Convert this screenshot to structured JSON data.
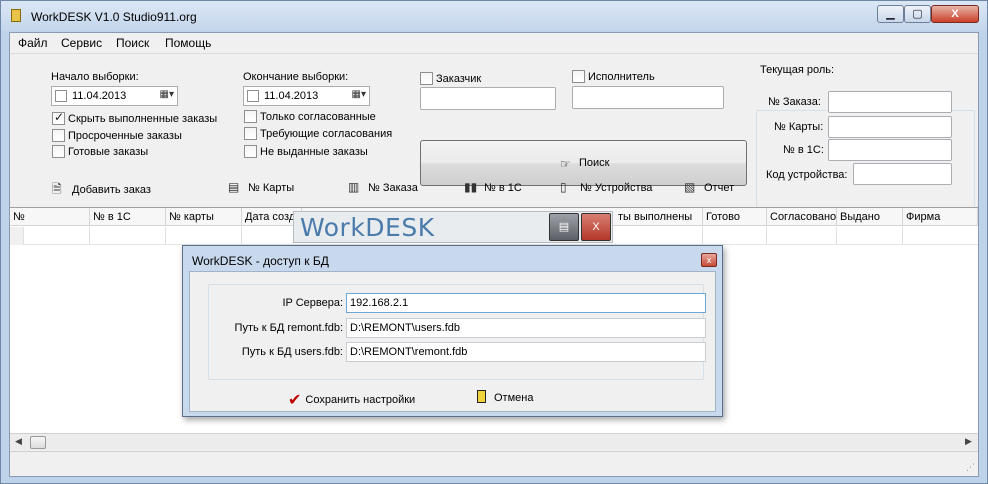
{
  "window": {
    "title": "WorkDESK V1.0 Studio911.org",
    "min_label": "▁",
    "max_label": "▢",
    "close_label": "X"
  },
  "menu": [
    "Файл",
    "Сервис",
    "Поиск",
    "Помощь"
  ],
  "filters": {
    "start_label": "Начало выборки:",
    "start_date": "11.04.2013",
    "end_label": "Окончание выборки:",
    "end_date": "11.04.2013",
    "left_checks": [
      {
        "label": "Скрыть выполненные заказы",
        "checked": true
      },
      {
        "label": "Просроченные заказы",
        "checked": false
      },
      {
        "label": "Готовые заказы",
        "checked": false
      }
    ],
    "right_checks": [
      {
        "label": "Только согласованные",
        "checked": false
      },
      {
        "label": "Требующие согласования",
        "checked": false
      },
      {
        "label": "Не выданные заказы",
        "checked": false
      }
    ],
    "customer_label": "Заказчик",
    "executor_label": "Исполнитель",
    "search_label": "Поиск"
  },
  "role": {
    "title": "Текущая роль:",
    "fields": [
      "№ Заказа:",
      "№ Карты:",
      "№ в 1С:",
      "Код устройства:"
    ]
  },
  "toolbar": [
    {
      "label": "Добавить заказ",
      "icon": "document-add-icon"
    },
    {
      "label": "№ Карты",
      "icon": "card-icon"
    },
    {
      "label": "№ Заказа",
      "icon": "orders-icon"
    },
    {
      "label": "№ в 1С",
      "icon": "barcode-icon"
    },
    {
      "label": "№ Устройства",
      "icon": "device-icon"
    },
    {
      "label": "Отчет",
      "icon": "report-icon"
    }
  ],
  "grid": {
    "columns": [
      "№",
      "№ в 1С",
      "№ карты",
      "Дата созд",
      "",
      "",
      "",
      "ты выполнены",
      "Готово",
      "Согласовано",
      "Выдано",
      "Фирма"
    ]
  },
  "splash": {
    "brand": "WorkDESK",
    "close_label": "X"
  },
  "dialog": {
    "title": "WorkDESK - доступ к БД",
    "close_label": "x",
    "server_label": "IP Сервера:",
    "server_value": "192.168.2.1",
    "path1_label": "Путь к БД remont.fdb:",
    "path1_value": "D:\\REMONT\\users.fdb",
    "path2_label": "Путь к БД users.fdb:",
    "path2_value": "D:\\REMONT\\remont.fdb",
    "save_label": "Сохранить настройки",
    "cancel_label": "Отмена"
  }
}
